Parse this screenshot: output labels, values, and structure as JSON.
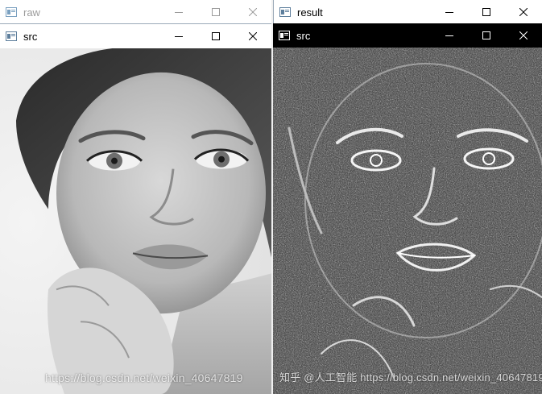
{
  "windows": {
    "raw": {
      "title": "raw"
    },
    "src_left": {
      "title": "src"
    },
    "result": {
      "title": "result"
    },
    "src_right": {
      "title": "src"
    }
  },
  "controls": {
    "minimize_icon": "minimize-icon",
    "maximize_icon": "maximize-icon",
    "close_icon": "close-icon"
  },
  "watermarks": {
    "left": "https://blog.csdn.net/weixin_40647819",
    "right": "知乎 @人工智能 https://blog.csdn.net/weixin_40647819"
  },
  "colors": {
    "titlebar_active": "#ffffff",
    "titlebar_dark": "#000000",
    "titlebar_inactive_text": "#9b9b9b"
  }
}
